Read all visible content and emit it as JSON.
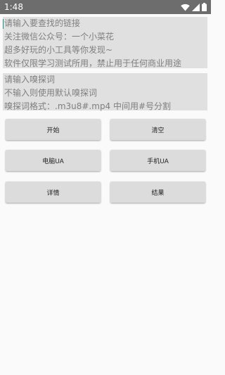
{
  "status_bar": {
    "time": "1:48",
    "icons": [
      "wifi-icon",
      "signal-icon",
      "battery-icon"
    ]
  },
  "url_input": {
    "placeholder_lines": [
      "请输入要查找的链接",
      "关注微信公众号：一个小菜花",
      "超多好玩的小工具等你发现~",
      "软件仅限学习测试所用，禁止用于任何商业用途"
    ]
  },
  "sniff_input": {
    "placeholder_lines": [
      "请输入嗅探词",
      "不输入则使用默认嗅探词",
      "嗅探词格式：.m3u8#.mp4 中间用#号分割"
    ]
  },
  "buttons": {
    "start": "开始",
    "clear": "清空",
    "pc_ua": "电脑UA",
    "mobile_ua": "手机UA",
    "details": "详情",
    "results": "结果"
  },
  "colors": {
    "status_bar_bg": "#6d6d6d",
    "input_bg": "#e0e0e0",
    "button_bg": "#dcdcdc",
    "cursor": "#1e8c7e"
  }
}
